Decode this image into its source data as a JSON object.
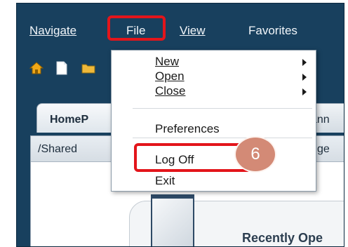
{
  "menubar": {
    "items": [
      {
        "label": "Navigate"
      },
      {
        "label": "File"
      },
      {
        "label": "View"
      },
      {
        "label": "Favorites"
      }
    ]
  },
  "toolbar": {
    "icons": [
      "home-icon",
      "new-document-icon",
      "folder-icon"
    ]
  },
  "tabs": {
    "home_label": "HomeP",
    "second_label": "ann"
  },
  "pathbar": {
    "path_text": "/Shared",
    "trailing_text": "ge"
  },
  "recent": {
    "title": "Recently Ope"
  },
  "file_menu": {
    "items": [
      {
        "label": "New",
        "has_submenu": true
      },
      {
        "label": "Open",
        "has_submenu": true
      },
      {
        "label": "Close",
        "has_submenu": true
      },
      {
        "label": "Preferences",
        "has_submenu": false
      },
      {
        "label": "Log Off",
        "has_submenu": false
      },
      {
        "label": "Exit",
        "has_submenu": false
      }
    ]
  },
  "annotation": {
    "step_number": "6",
    "highlight_color": "#e3151b",
    "badge_color": "#d38a76"
  }
}
